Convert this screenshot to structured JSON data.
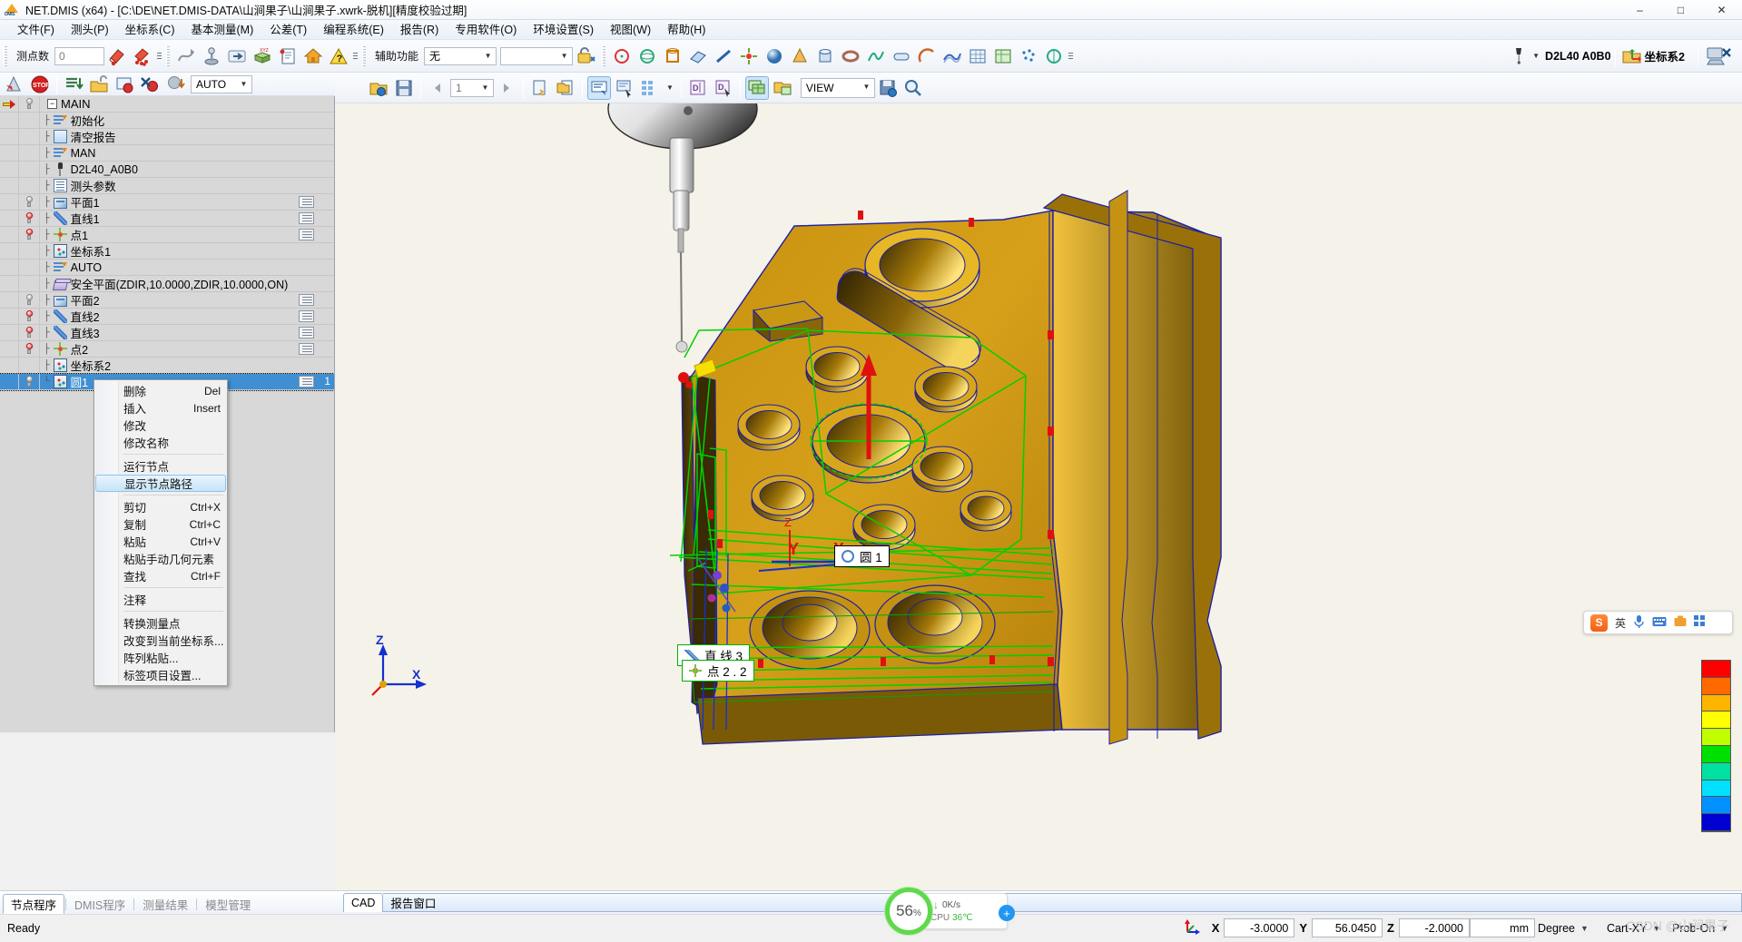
{
  "window": {
    "title": "NET.DMIS (x64) - [C:\\DE\\NET.DMIS-DATA\\山涧果子\\山涧果子.xwrk-脱机][精度校验过期]",
    "minimize": "–",
    "maximize": "□",
    "close": "✕"
  },
  "menu": [
    {
      "label": "文件(F)"
    },
    {
      "label": "测头(P)"
    },
    {
      "label": "坐标系(C)"
    },
    {
      "label": "基本测量(M)"
    },
    {
      "label": "公差(T)"
    },
    {
      "label": "编程系统(E)"
    },
    {
      "label": "报告(R)"
    },
    {
      "label": "专用软件(O)"
    },
    {
      "label": "环境设置(S)"
    },
    {
      "label": "视图(W)"
    },
    {
      "label": "帮助(H)"
    }
  ],
  "toolbar": {
    "points_label": "测点数",
    "points_value": "0",
    "aux_label": "辅助功能",
    "aux_value": "无",
    "probe_name": "D2L40  A0B0",
    "csys_name": "坐标系2"
  },
  "tree_toolbar": {
    "mode_value": "AUTO"
  },
  "cad_toolbar": {
    "page_value": "1",
    "view_value": "VIEW"
  },
  "tree": {
    "root": "MAIN",
    "items": [
      {
        "label": "初始化",
        "icon": "lines-init-icon",
        "bulb": "none",
        "badge": false
      },
      {
        "label": "清空报告",
        "icon": "clear-report-icon",
        "bulb": "none",
        "badge": false
      },
      {
        "label": "MAN",
        "icon": "mode-icon",
        "bulb": "none",
        "badge": false
      },
      {
        "label": "D2L40_A0B0",
        "icon": "probe-icon",
        "bulb": "none",
        "badge": false
      },
      {
        "label": "测头参数",
        "icon": "probe-params-icon",
        "bulb": "none",
        "badge": false
      },
      {
        "label": "平面1",
        "icon": "plane-icon",
        "bulb": "off",
        "badge": true
      },
      {
        "label": "直线1",
        "icon": "line-icon",
        "bulb": "on",
        "badge": true
      },
      {
        "label": "点1",
        "icon": "point-icon",
        "bulb": "on",
        "badge": true
      },
      {
        "label": "坐标系1",
        "icon": "csys-icon",
        "bulb": "none",
        "badge": false
      },
      {
        "label": "AUTO",
        "icon": "mode-icon",
        "bulb": "none",
        "badge": false
      },
      {
        "label": "安全平面(ZDIR,10.0000,ZDIR,10.0000,ON)",
        "icon": "safeplane-icon",
        "bulb": "none",
        "badge": false
      },
      {
        "label": "平面2",
        "icon": "plane-icon",
        "bulb": "off",
        "badge": true
      },
      {
        "label": "直线2",
        "icon": "line-icon",
        "bulb": "on",
        "badge": true
      },
      {
        "label": "直线3",
        "icon": "line-icon",
        "bulb": "on",
        "badge": true
      },
      {
        "label": "点2",
        "icon": "point-icon",
        "bulb": "on",
        "badge": true
      },
      {
        "label": "坐标系2",
        "icon": "csys-icon",
        "bulb": "none",
        "badge": false
      },
      {
        "label": "圆1",
        "icon": "circle-icon",
        "bulb": "off",
        "badge": true,
        "selected": true,
        "number": "1"
      }
    ]
  },
  "context_menu": [
    {
      "label": "删除",
      "accel": "Del"
    },
    {
      "label": "插入",
      "accel": "Insert"
    },
    {
      "label": "修改",
      "accel": ""
    },
    {
      "label": "修改名称",
      "accel": ""
    },
    {
      "sep": true
    },
    {
      "label": "运行节点",
      "accel": ""
    },
    {
      "label": "显示节点路径",
      "accel": "",
      "highlighted": true
    },
    {
      "sep": true
    },
    {
      "label": "剪切",
      "accel": "Ctrl+X"
    },
    {
      "label": "复制",
      "accel": "Ctrl+C"
    },
    {
      "label": "粘贴",
      "accel": "Ctrl+V"
    },
    {
      "label": "粘贴手动几何元素",
      "accel": ""
    },
    {
      "label": "查找",
      "accel": "Ctrl+F"
    },
    {
      "sep": true
    },
    {
      "label": "注释",
      "accel": ""
    },
    {
      "sep": true
    },
    {
      "label": "转换测量点",
      "accel": ""
    },
    {
      "label": "改变到当前坐标系...",
      "accel": ""
    },
    {
      "label": "阵列粘贴...",
      "accel": ""
    },
    {
      "label": "标签项目设置...",
      "accel": ""
    }
  ],
  "viewport": {
    "labels": [
      {
        "name": "circle-1-label",
        "text": "圆  1"
      },
      {
        "name": "line-3-label",
        "text": "直 线  3"
      },
      {
        "name": "point-2-label",
        "text": "点  2 . 2"
      }
    ],
    "axis_markers": [
      "Z",
      "X",
      "Y"
    ]
  },
  "cad_tabs": [
    {
      "label": "CAD",
      "active": true
    },
    {
      "label": "报告窗口",
      "active": false
    }
  ],
  "cpu_widget": {
    "percent": "56",
    "percent_sign": "%",
    "net_speed": "0K/s",
    "cpu_label": "CPU",
    "cpu_temp": "36℃",
    "plus": "+"
  },
  "bottom_tabs": [
    {
      "label": "节点程序",
      "active": true
    },
    {
      "label": "DMIS程序",
      "active": false
    },
    {
      "label": "测量结果",
      "active": false
    },
    {
      "label": "模型管理",
      "active": false
    }
  ],
  "status": {
    "ready": "Ready",
    "x_label": "X",
    "x_value": "-3.0000",
    "y_label": "Y",
    "y_value": "56.0450",
    "z_label": "Z",
    "z_value": "-2.0000",
    "unit": "mm",
    "angle_mode": "Degree",
    "coord_mode": "Cart-XY",
    "probe_mode": "Prob-On",
    "watermark": "CSDN @山涧果子"
  },
  "ime": {
    "lang": "S",
    "mode": "英"
  },
  "legend_colors": [
    "#ff0000",
    "#ff6a00",
    "#ffb400",
    "#ffff00",
    "#bfff00",
    "#00e000",
    "#00e0a0",
    "#00e0ff",
    "#0090ff",
    "#0000d0"
  ]
}
